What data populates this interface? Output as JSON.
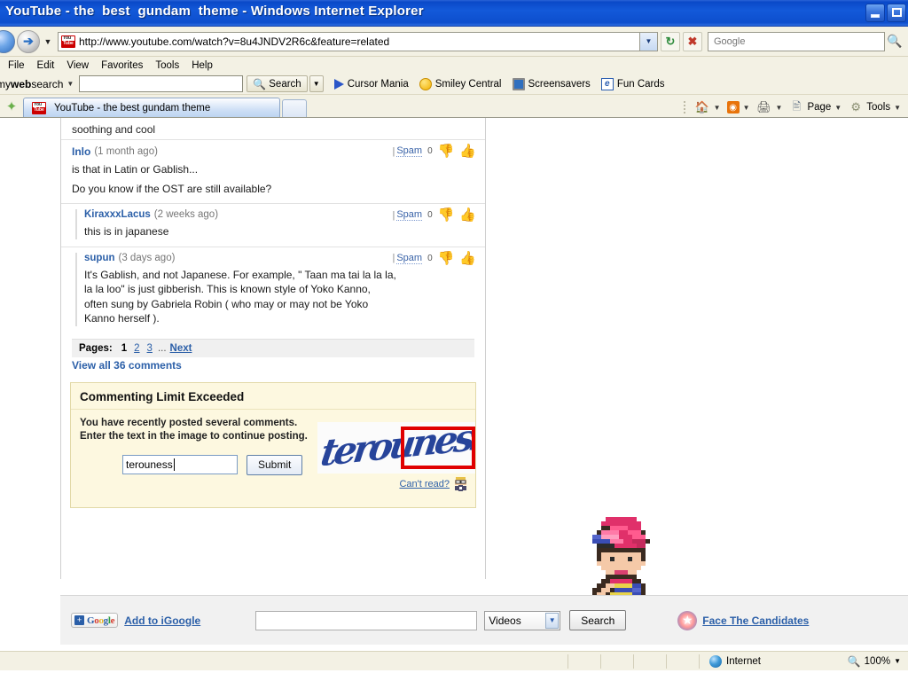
{
  "window": {
    "title": "YouTube - the  best  gundam  theme - Windows Internet Explorer",
    "minimize_label": "Minimize",
    "restore_label": "Restore"
  },
  "browser": {
    "back_label": "Back",
    "forward_label": "Forward",
    "history_label": "Recent Pages",
    "address_url": "http://www.youtube.com/watch?v=8u4JNDV2R6c&feature=related",
    "address_dropdown_label": "Address dropdown",
    "refresh_label": "Refresh",
    "stop_label": "Stop",
    "search_placeholder": "Google",
    "search_value": "",
    "search_go_label": "Search",
    "favicon_name": "youtube-favicon"
  },
  "menu": {
    "items": [
      "File",
      "Edit",
      "View",
      "Favorites",
      "Tools",
      "Help"
    ]
  },
  "mywebsearch": {
    "brand_my": "my",
    "brand_web": "web",
    "brand_search": "search",
    "input_value": "",
    "search_button": "Search",
    "links": [
      {
        "label": "Cursor Mania",
        "icon": "cursor-icon"
      },
      {
        "label": "Smiley Central",
        "icon": "smiley-icon"
      },
      {
        "label": "Screensavers",
        "icon": "monitor-icon"
      },
      {
        "label": "Fun Cards",
        "icon": "funcards-icon"
      }
    ]
  },
  "tabs": {
    "favorites_label": "Favorites",
    "active_tab": "YouTube - the  best  gundam  theme",
    "new_tab_label": "New Tab"
  },
  "command_bar": {
    "home": "Home",
    "feeds": "Feeds",
    "print": "Print",
    "page": "Page",
    "tools": "Tools"
  },
  "page": {
    "partial_comment_top": "soothing and cool",
    "comments": [
      {
        "author": "Inlo",
        "time": "(1 month ago)",
        "spam": "Spam",
        "votes": "0",
        "reply": false,
        "body_lines": [
          "is that in Latin or Gablish...",
          "Do you know if the OST are still available?"
        ]
      },
      {
        "author": "KiraxxxLacus",
        "time": "(2 weeks ago)",
        "spam": "Spam",
        "votes": "0",
        "reply": true,
        "body_lines": [
          "this is in japanese"
        ]
      },
      {
        "author": "supun",
        "time": "(3 days ago)",
        "spam": "Spam",
        "votes": "0",
        "reply": true,
        "body_lines": [
          "It's Gablish, and not Japanese. For example, \" Taan ma tai la la la, la la loo\" is just gibberish. This is known style of Yoko Kanno, often sung by Gabriela Robin ( who may or may not be Yoko Kanno herself )."
        ]
      }
    ],
    "pages": {
      "label": "Pages:",
      "current": "1",
      "others": [
        "2",
        "3"
      ],
      "ellipsis": "...",
      "next": "Next"
    },
    "view_all": "View all 36 comments",
    "captcha": {
      "title": "Commenting Limit Exceeded",
      "message_line1": "You have recently posted several comments.",
      "message_line2": "Enter the text in the image to continue posting.",
      "input_value": "terouness",
      "submit_label": "Submit",
      "image_word": "terouness",
      "cant_read_label": "Can't read?",
      "highlight_color": "#e00000"
    }
  },
  "gfooter": {
    "igoogle_label": "Add to iGoogle",
    "google_logo": "Google",
    "search_value": "",
    "category_selected": "Videos",
    "search_button": "Search",
    "candidates_label": "Face The Candidates"
  },
  "statusbar": {
    "zone": "Internet",
    "zoom": "100%"
  }
}
